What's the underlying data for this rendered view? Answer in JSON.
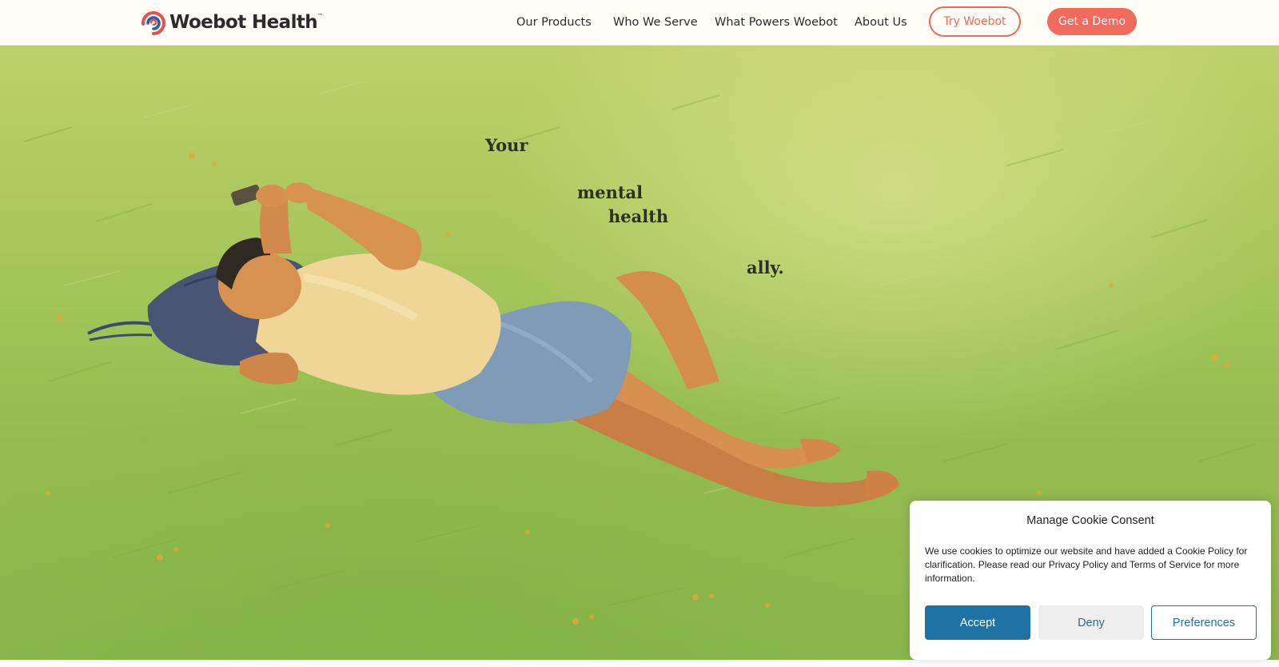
{
  "header": {
    "logo_text": "Woebot Health",
    "logo_tm": "™",
    "nav": [
      "Our Products",
      "Who We Serve",
      "What Powers Woebot",
      "About Us"
    ],
    "try_button": "Try Woebot",
    "demo_button": "Get a Demo"
  },
  "hero": {
    "headline": [
      "Your",
      "mental",
      "health",
      "ally."
    ]
  },
  "cookie": {
    "title": "Manage Cookie Consent",
    "text": "We use cookies to optimize our website and have added a Cookie Policy for clarification. Please read our Privacy Policy and Terms of Service for more information.",
    "accept": "Accept",
    "deny": "Deny",
    "preferences": "Preferences"
  },
  "colors": {
    "brand_coral": "#ef6a5a",
    "brand_blue": "#1e73a4",
    "header_bg": "#fffdf6",
    "grass": "#9cc257"
  }
}
